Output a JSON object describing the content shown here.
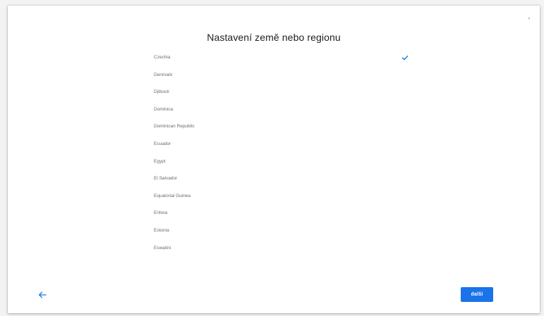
{
  "page": {
    "title": "Nastavení země nebo regionu"
  },
  "countries": [
    {
      "label": "Czechia",
      "selected": true
    },
    {
      "label": "Denmark",
      "selected": false
    },
    {
      "label": "Djibouti",
      "selected": false
    },
    {
      "label": "Dominica",
      "selected": false
    },
    {
      "label": "Dominican Republic",
      "selected": false
    },
    {
      "label": "Ecuador",
      "selected": false
    },
    {
      "label": "Egypt",
      "selected": false
    },
    {
      "label": "El Salvador",
      "selected": false
    },
    {
      "label": "Equatorial Guinea",
      "selected": false
    },
    {
      "label": "Eritrea",
      "selected": false
    },
    {
      "label": "Estonia",
      "selected": false
    },
    {
      "label": "Eswatini",
      "selected": false
    }
  ],
  "icons": {
    "check": "check-icon",
    "back": "arrow-back-icon"
  },
  "footer": {
    "next_label": "další"
  },
  "colors": {
    "accent": "#1a73e8",
    "text": "#202124",
    "list_text": "#6b6b6b"
  }
}
